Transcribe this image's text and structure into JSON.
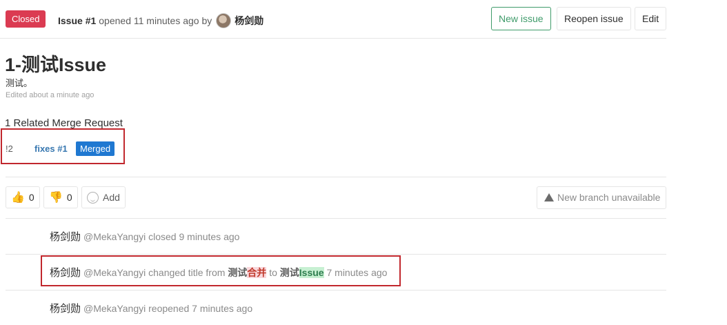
{
  "header": {
    "status": "Closed",
    "issue_ref": "Issue #1",
    "opened_text": "opened 11 minutes ago by",
    "author": "杨剑勋",
    "buttons": {
      "new_issue": "New issue",
      "reopen_issue": "Reopen issue",
      "edit": "Edit"
    }
  },
  "issue": {
    "title": "1-测试Issue",
    "description": "测试。",
    "edited": "Edited about a minute ago"
  },
  "merge_requests": {
    "heading": "1 Related Merge Request",
    "items": [
      {
        "ref": "!2",
        "title": "fixes #1",
        "status": "Merged"
      }
    ]
  },
  "awards": {
    "thumbsup_count": "0",
    "thumbsdown_count": "0",
    "add_label": "Add"
  },
  "new_branch": "New branch unavailable",
  "notes": [
    {
      "name": "杨剑勋",
      "handle": "@MekaYangyi",
      "text": "closed 9 minutes ago"
    },
    {
      "name": "杨剑勋",
      "handle": "@MekaYangyi",
      "pre": "changed title from",
      "old_a": "测试",
      "old_b": "合并",
      "mid": "to",
      "new_a": "测试",
      "new_b": "Issue",
      "time": "7 minutes ago"
    },
    {
      "name": "杨剑勋",
      "handle": "@MekaYangyi",
      "text": "reopened 7 minutes ago"
    }
  ],
  "colors": {
    "closed": "#db3b52",
    "merged": "#1f78d1",
    "new_issue": "#3f9b6a",
    "highlight_box": "#c1272d"
  }
}
